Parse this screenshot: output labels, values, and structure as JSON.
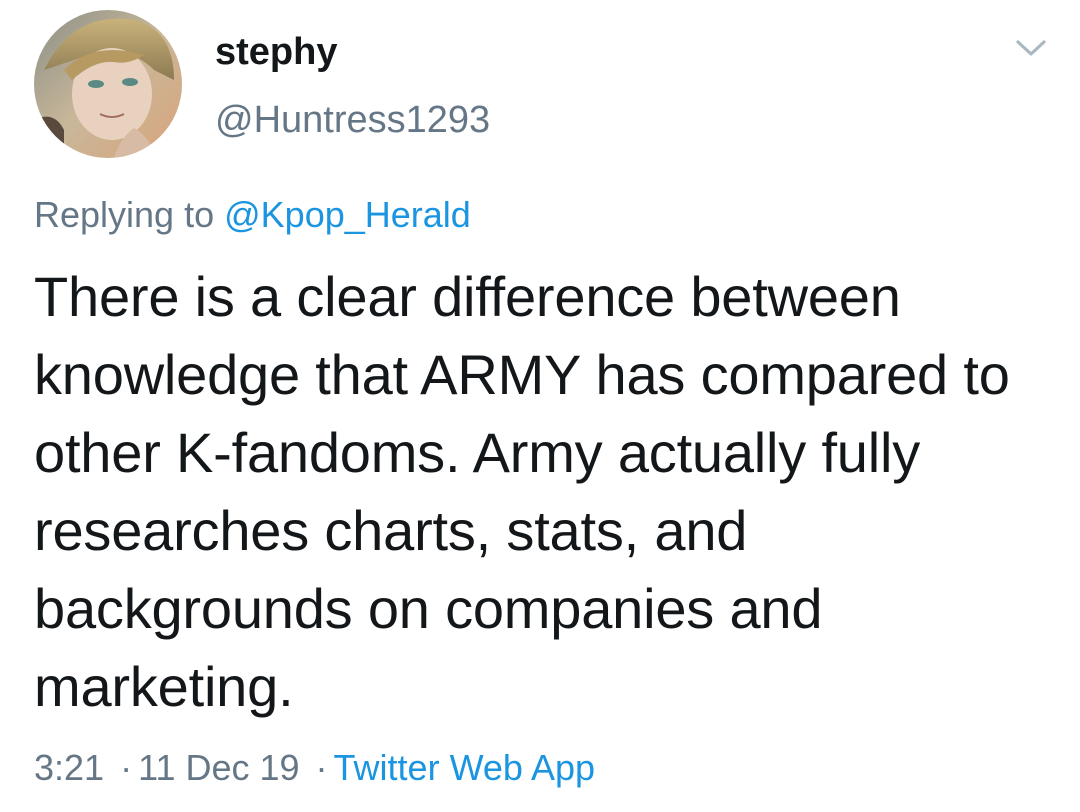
{
  "author": {
    "display_name": "stephy",
    "handle": "@Huntress1293",
    "avatar_icon": "anime-character-avatar"
  },
  "reply": {
    "prefix": "Replying to",
    "mention": "@Kpop_Herald"
  },
  "tweet": {
    "text": "There is a clear difference between knowledge that ARMY has compared to other K-fandoms. Army actually fully researches charts, stats, and backgrounds on companies and marketing."
  },
  "meta": {
    "time": "3:21",
    "separator": "·",
    "date": "11 Dec 19",
    "source": "Twitter Web App"
  },
  "menu": {
    "icon": "chevron-down-icon"
  },
  "colors": {
    "text": "#14171a",
    "secondary": "#657786",
    "link": "#1b95e0",
    "background": "#ffffff"
  }
}
